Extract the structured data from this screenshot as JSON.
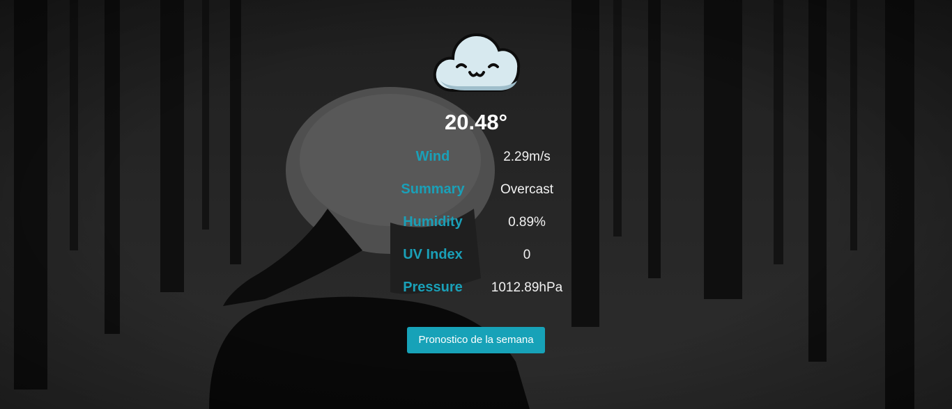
{
  "weather": {
    "icon": "cloud-icon",
    "temperature": "20.48°",
    "rows": [
      {
        "label": "Wind",
        "value": "2.29m/s"
      },
      {
        "label": "Summary",
        "value": "Overcast"
      },
      {
        "label": "Humidity",
        "value": "0.89%"
      },
      {
        "label": "UV Index",
        "value": "0"
      },
      {
        "label": "Pressure",
        "value": "1012.89hPa"
      }
    ]
  },
  "forecast_button": {
    "label": "Pronostico de la semana"
  },
  "colors": {
    "accent": "#17a2b8",
    "label_text": "#1aa0b8",
    "value_text": "#f2f2f2",
    "background": "#1d1d1d"
  }
}
